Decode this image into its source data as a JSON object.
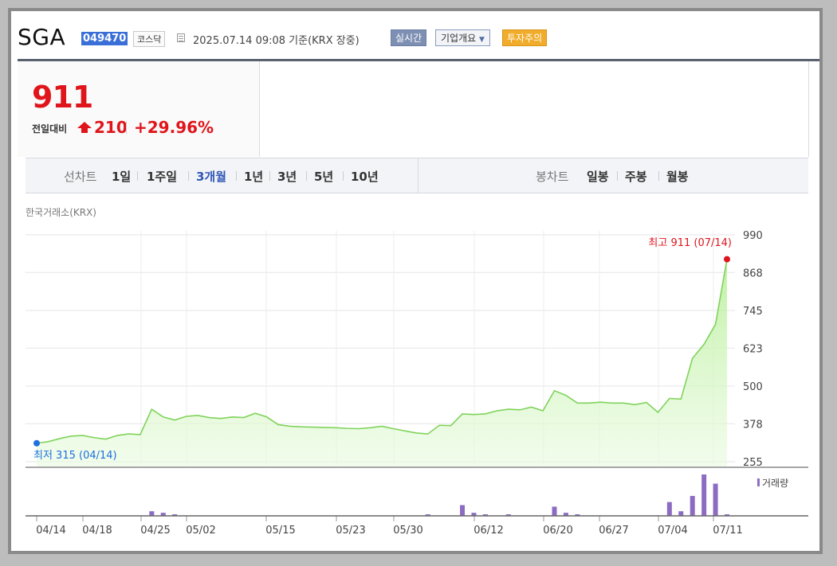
{
  "header": {
    "name": "SGA",
    "code": "049470",
    "market": "코스닥",
    "datetime": "2025.07.14 09:08  기준(KRX 장중)",
    "realtime_btn": "실시간",
    "company_btn": "기업개요",
    "warning_badge": "투자주의"
  },
  "price": {
    "current": "911",
    "change_label": "전일대비",
    "change": "210",
    "change_pct": "+29.96%"
  },
  "tabs": {
    "line_label": "선차트",
    "line": [
      "1일",
      "1주일",
      "3개월",
      "1년",
      "3년",
      "5년",
      "10년"
    ],
    "active": "3개월",
    "candle_label": "봉차트",
    "candle": [
      "일봉",
      "주봉",
      "월봉"
    ]
  },
  "source": "한국거래소(KRX)",
  "colors": {
    "up": "#e0151b",
    "line": "#7fd35a",
    "volume": "#8c6cc2",
    "low_marker": "#1f6fe0"
  },
  "chart_data": {
    "type": "area",
    "y_ticks": [
      "990",
      "868",
      "745",
      "623",
      "500",
      "378",
      "255"
    ],
    "ylim": [
      255,
      990
    ],
    "x_ticks": [
      "04/14",
      "04/18",
      "04/25",
      "05/02",
      "05/15",
      "05/23",
      "05/30",
      "06/12",
      "06/20",
      "06/27",
      "07/04",
      "07/11"
    ],
    "series": [
      {
        "values": [
          315,
          320,
          330,
          338,
          340,
          333,
          328,
          340,
          345,
          343,
          425,
          400,
          390,
          402,
          405,
          398,
          395,
          400,
          398,
          412,
          400,
          375,
          370,
          368,
          367,
          366,
          365,
          363,
          362,
          365,
          370,
          362,
          355,
          348,
          345,
          373,
          372,
          410,
          408,
          410,
          420,
          425,
          423,
          432,
          420,
          485,
          470,
          445,
          445,
          448,
          445,
          445,
          440,
          447,
          415,
          460,
          458,
          590,
          635,
          700,
          911
        ]
      }
    ],
    "volume_label": "거래량",
    "volume": [
      0,
      0,
      0,
      0,
      0,
      0,
      0,
      0,
      0,
      0,
      3,
      2,
      1,
      0,
      0,
      0,
      0,
      0,
      0,
      0,
      0,
      0,
      0,
      0,
      0,
      0,
      0,
      0,
      0,
      0,
      0,
      0,
      0,
      0,
      1,
      0,
      0,
      7,
      2,
      1,
      0,
      1,
      0,
      0,
      0,
      6,
      2,
      1,
      0,
      0,
      0,
      0,
      0,
      0,
      0,
      9,
      3,
      13,
      27,
      21,
      1
    ],
    "annotations": {
      "high": "최고 911 (07/14)",
      "low": "최저 315 (04/14)"
    }
  }
}
